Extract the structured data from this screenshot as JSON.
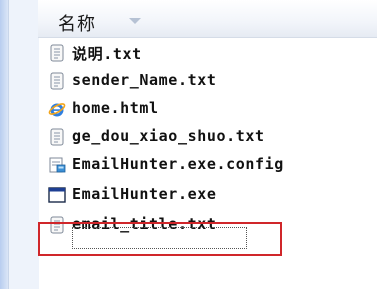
{
  "header": {
    "column_label": "名称"
  },
  "files": [
    {
      "name": "说明.txt",
      "icon": "text-file-icon"
    },
    {
      "name": "sender_Name.txt",
      "icon": "text-file-icon"
    },
    {
      "name": "home.html",
      "icon": "ie-html-icon"
    },
    {
      "name": "ge_dou_xiao_shuo.txt",
      "icon": "text-file-icon"
    },
    {
      "name": "EmailHunter.exe.config",
      "icon": "config-file-icon"
    },
    {
      "name": "EmailHunter.exe",
      "icon": "exe-window-icon"
    },
    {
      "name": "email_title.txt",
      "icon": "text-file-icon"
    }
  ],
  "colors": {
    "highlight": "#d0262a",
    "ie_blue": "#1f6fd1",
    "ie_ring": "#f2a51b"
  }
}
